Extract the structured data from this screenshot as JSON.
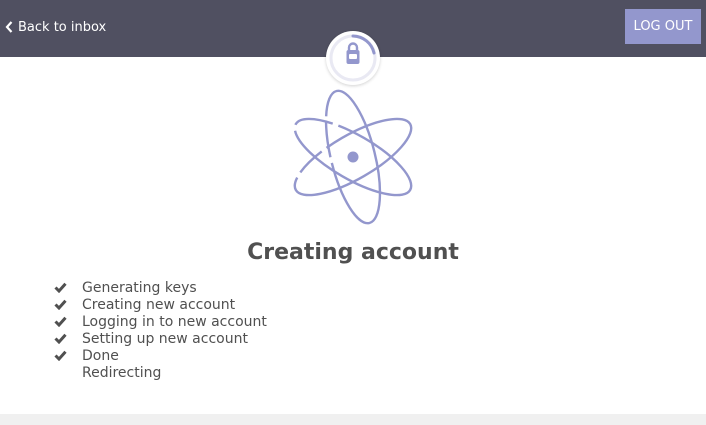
{
  "header": {
    "back_label": "Back to inbox",
    "logout_label": "LOG OUT"
  },
  "main": {
    "title": "Creating account",
    "steps": [
      {
        "label": "Generating keys",
        "done": true
      },
      {
        "label": "Creating new account",
        "done": true
      },
      {
        "label": "Logging in to new account",
        "done": true
      },
      {
        "label": "Setting up new account",
        "done": true
      },
      {
        "label": "Done",
        "done": true
      },
      {
        "label": "Redirecting",
        "done": false
      }
    ]
  },
  "colors": {
    "topbar": "#505061",
    "accent": "#9397cd",
    "text": "#505050"
  },
  "icons": {
    "back": "chevron-left-icon",
    "badge": "lock-icon",
    "illustration": "atom-icon",
    "step": "check-icon"
  }
}
